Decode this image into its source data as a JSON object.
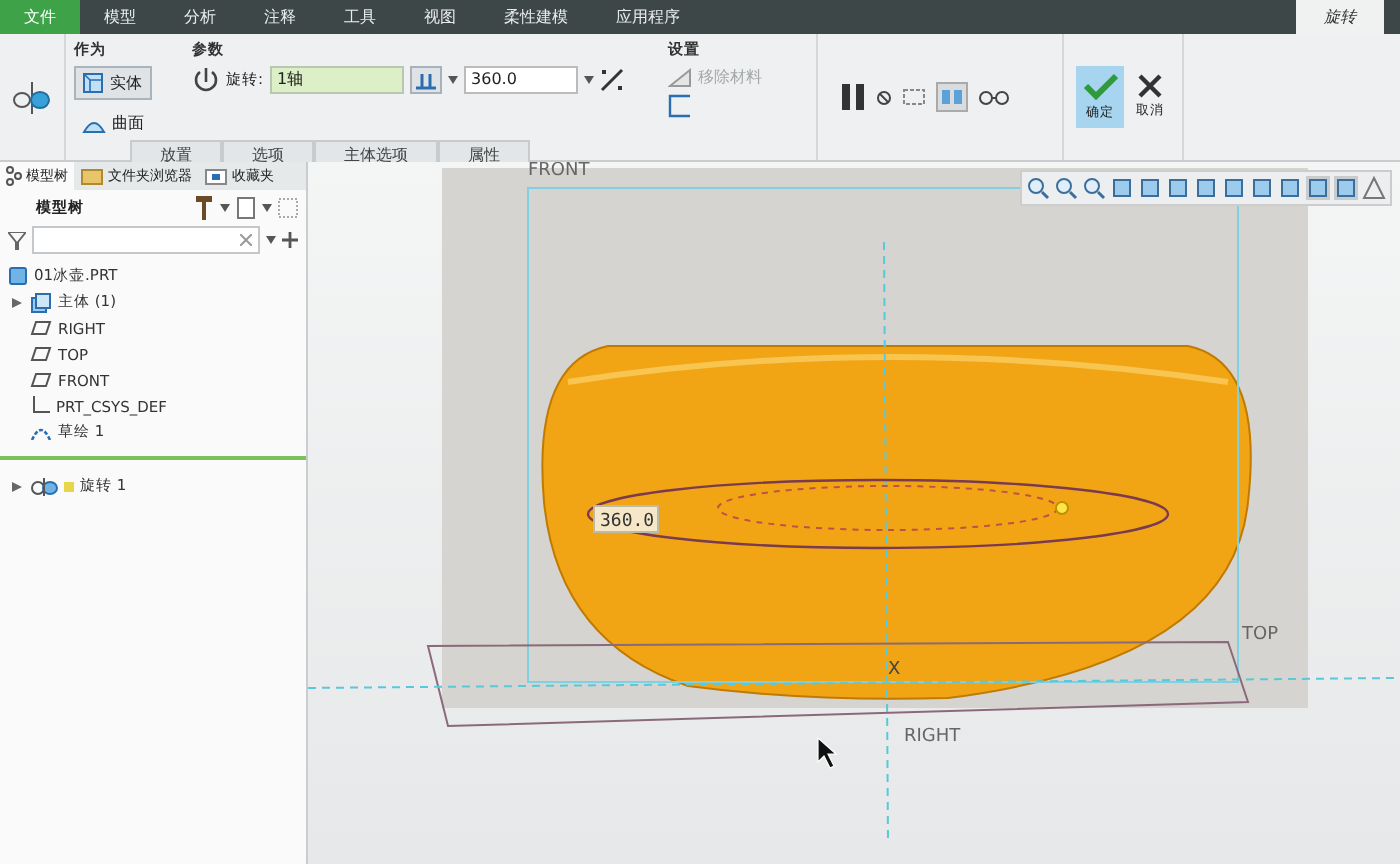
{
  "menu_tabs": [
    {
      "label": "文件",
      "kind": "file",
      "selected": false
    },
    {
      "label": "模型",
      "kind": "tab",
      "selected": false
    },
    {
      "label": "分析",
      "kind": "tab",
      "selected": false
    },
    {
      "label": "注释",
      "kind": "tab",
      "selected": false
    },
    {
      "label": "工具",
      "kind": "tab",
      "selected": false
    },
    {
      "label": "视图",
      "kind": "tab",
      "selected": false
    },
    {
      "label": "柔性建模",
      "kind": "tab",
      "selected": false
    },
    {
      "label": "应用程序",
      "kind": "tab",
      "selected": false
    },
    {
      "label": "旋转",
      "kind": "tab",
      "selected": true
    }
  ],
  "ribbon": {
    "as_group": {
      "title": "作为",
      "options": [
        {
          "label": "实体",
          "kind": "solid",
          "selected": true
        },
        {
          "label": "曲面",
          "kind": "surface",
          "selected": false
        }
      ]
    },
    "params": {
      "title": "参数",
      "rotate_label": "旋转:",
      "axis_value": "1轴",
      "angle_value": "360.0"
    },
    "settings": {
      "title": "设置",
      "remove_material": {
        "label": "移除材料",
        "disabled": true
      }
    },
    "subtabs": [
      "放置",
      "选项",
      "主体选项",
      "属性"
    ],
    "ok_label": "确定",
    "cancel_label": "取消"
  },
  "left_panel": {
    "tabs": [
      {
        "label": "模型树",
        "kind": "tree",
        "selected": true
      },
      {
        "label": "文件夹浏览器",
        "kind": "folder",
        "selected": false
      },
      {
        "label": "收藏夹",
        "kind": "favorites",
        "selected": false
      }
    ],
    "tree_title": "模型树",
    "tree": [
      {
        "label": "01冰壶.PRT",
        "kind": "part",
        "children": [
          {
            "label": "主体 (1)",
            "kind": "body",
            "expanded": false
          },
          {
            "label": "RIGHT",
            "kind": "plane"
          },
          {
            "label": "TOP",
            "kind": "plane"
          },
          {
            "label": "FRONT",
            "kind": "plane"
          },
          {
            "label": "PRT_CSYS_DEF",
            "kind": "csys"
          },
          {
            "label": "草绘 1",
            "kind": "sketch"
          },
          {
            "label": "旋转 1",
            "kind": "revolve",
            "expanded": false,
            "insert_marker": true
          }
        ]
      }
    ]
  },
  "viewport": {
    "dimension": "360.0",
    "plane_labels": [
      {
        "label": "FRONT",
        "kind": "front"
      },
      {
        "label": "TOP",
        "kind": "top"
      },
      {
        "label": "RIGHT",
        "kind": "right"
      }
    ],
    "axis_label": "X"
  }
}
